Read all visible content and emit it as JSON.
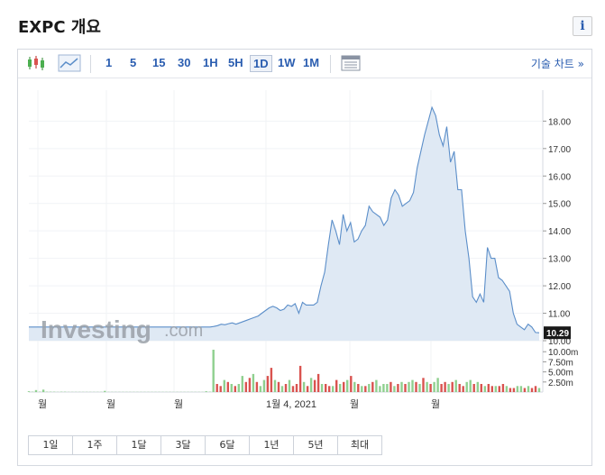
{
  "header": {
    "title": "EXPC 개요",
    "info_label": "i"
  },
  "toolbar": {
    "timeframes": [
      "1",
      "5",
      "15",
      "30",
      "1H",
      "5H",
      "1D",
      "1W",
      "1M"
    ],
    "active_timeframe": "1D",
    "technical_chart_label": "기술 차트 »"
  },
  "watermark": {
    "main": "Investing",
    "suffix": ".com"
  },
  "range_buttons": [
    "1일",
    "1주",
    "1달",
    "3달",
    "6달",
    "1년",
    "5년",
    "최대"
  ],
  "colors": {
    "line": "#5b8ec9",
    "area": "#dfe9f4",
    "volume_up": "#8fd08f",
    "volume_down": "#d9534f",
    "price_tag": "#1a1a1a"
  },
  "chart_data": {
    "type": "area",
    "price_axis": {
      "ticks": [
        "18.00",
        "17.00",
        "16.00",
        "15.00",
        "14.00",
        "13.00",
        "12.00",
        "11.00",
        "10.00"
      ],
      "ylim": [
        10.0,
        18.8
      ]
    },
    "current_price_label": "10.29",
    "x_tick_labels": [
      "월",
      "월",
      "월",
      "1월 4, 2021",
      "월",
      "월"
    ],
    "series": [
      {
        "values": [
          10.5,
          10.5,
          10.5,
          10.5,
          10.5,
          10.5,
          10.5,
          10.5,
          10.5,
          10.5,
          10.5,
          10.5,
          10.5,
          10.5,
          10.5,
          10.5,
          10.5,
          10.5,
          10.5,
          10.5,
          10.5,
          10.5,
          10.5,
          10.5,
          10.5,
          10.5,
          10.5,
          10.5,
          10.5,
          10.5,
          10.5,
          10.5,
          10.5,
          10.5,
          10.5,
          10.5,
          10.5,
          10.5,
          10.5,
          10.5,
          10.5,
          10.5,
          10.5,
          10.5,
          10.5,
          10.5,
          10.5,
          10.5,
          10.5,
          10.5,
          10.52,
          10.55,
          10.6,
          10.58,
          10.62,
          10.65,
          10.6,
          10.65,
          10.7,
          10.75,
          10.8,
          10.85,
          10.9,
          11.0,
          11.1,
          11.2,
          11.25,
          11.2,
          11.1,
          11.15,
          11.3,
          11.25,
          11.35,
          11.0,
          11.4,
          11.3,
          11.3,
          11.3,
          11.4,
          12.0,
          12.5,
          13.5,
          14.4,
          14.0,
          13.5,
          14.6,
          14.0,
          14.3,
          13.6,
          13.7,
          14.0,
          14.2,
          14.9,
          14.7,
          14.6,
          14.5,
          14.2,
          14.4,
          15.2,
          15.5,
          15.3,
          14.9,
          15.0,
          15.1,
          15.4,
          16.3,
          16.9,
          17.5,
          18.0,
          18.5,
          18.2,
          17.5,
          17.1,
          17.8,
          16.5,
          16.9,
          15.5,
          15.5,
          14.0,
          13.0,
          11.6,
          11.4,
          11.7,
          11.4,
          13.4,
          13.0,
          13.0,
          12.3,
          12.2,
          12.0,
          11.8,
          11.0,
          10.6,
          10.5,
          10.4,
          10.6,
          10.5,
          10.3,
          10.29
        ]
      }
    ],
    "volume_axis": {
      "ticks": [
        "10.00m",
        "7.50m",
        "5.00m",
        "2.50m"
      ],
      "ylim": [
        0,
        10.5
      ]
    },
    "volume": [
      0.2,
      0.1,
      0.5,
      0.1,
      0.6,
      0.1,
      0.1,
      0.1,
      0.05,
      0.1,
      0.1,
      0.05,
      0.05,
      0.05,
      0.05,
      0.05,
      0.05,
      0.05,
      0.05,
      0.05,
      0.05,
      0.3,
      0.05,
      0.05,
      0.05,
      0.05,
      0.05,
      0.05,
      0.05,
      0.05,
      0.05,
      0.05,
      0.05,
      0.05,
      0.05,
      0.05,
      0.05,
      0.05,
      0.05,
      0.05,
      0.05,
      0.05,
      0.05,
      0.05,
      0.05,
      0.05,
      0.05,
      0.05,
      0.05,
      0.2,
      0.1,
      11.0,
      2.0,
      1.5,
      3.0,
      2.5,
      2.0,
      1.5,
      2.0,
      4.0,
      2.5,
      3.5,
      4.5,
      2.5,
      1.5,
      3.0,
      4.0,
      6.0,
      3.0,
      2.5,
      1.5,
      2.0,
      3.0,
      1.5,
      2.0,
      6.5,
      2.5,
      1.5,
      3.5,
      3.0,
      4.5,
      2.0,
      2.0,
      1.5,
      1.5,
      3.0,
      2.0,
      2.5,
      3.0,
      4.0,
      2.5,
      2.0,
      1.5,
      1.5,
      2.0,
      2.5,
      3.0,
      1.5,
      2.0,
      2.0,
      2.5,
      1.5,
      2.0,
      2.5,
      2.0,
      2.5,
      3.0,
      2.5,
      2.0,
      3.5,
      2.5,
      2.0,
      2.5,
      3.5,
      2.0,
      2.5,
      2.0,
      2.5,
      3.0,
      2.0,
      1.5,
      2.5,
      3.0,
      2.0,
      2.5,
      2.0,
      1.5,
      2.0,
      1.5,
      1.5,
      1.5,
      2.0,
      1.5,
      1.0,
      1.0,
      1.5,
      1.5,
      1.0,
      1.5,
      1.0,
      1.5,
      1.0
    ],
    "volume_up": [
      true,
      true,
      true,
      true,
      true,
      true,
      true,
      true,
      true,
      true,
      true,
      true,
      true,
      true,
      true,
      true,
      true,
      true,
      true,
      true,
      true,
      true,
      true,
      true,
      true,
      true,
      true,
      true,
      true,
      true,
      true,
      true,
      true,
      true,
      true,
      true,
      true,
      true,
      true,
      true,
      true,
      true,
      true,
      true,
      true,
      true,
      true,
      true,
      true,
      true,
      true,
      true,
      false,
      false,
      true,
      false,
      true,
      false,
      true,
      true,
      false,
      false,
      true,
      false,
      true,
      true,
      false,
      false,
      true,
      false,
      true,
      false,
      true,
      false,
      false,
      false,
      true,
      false,
      true,
      false,
      false,
      true,
      false,
      false,
      true,
      false,
      true,
      false,
      true,
      false,
      true,
      false,
      true,
      false,
      true,
      false,
      true,
      true,
      true,
      true,
      false,
      true,
      false,
      true,
      false,
      true,
      true,
      false,
      true,
      false,
      true,
      false,
      true,
      true,
      false,
      false,
      true,
      false,
      true,
      false,
      false,
      true,
      true,
      false,
      true,
      false,
      true,
      false,
      false,
      true,
      false,
      false,
      true,
      false,
      false,
      true,
      true,
      false,
      true,
      false,
      false,
      true,
      false,
      false,
      true
    ]
  }
}
